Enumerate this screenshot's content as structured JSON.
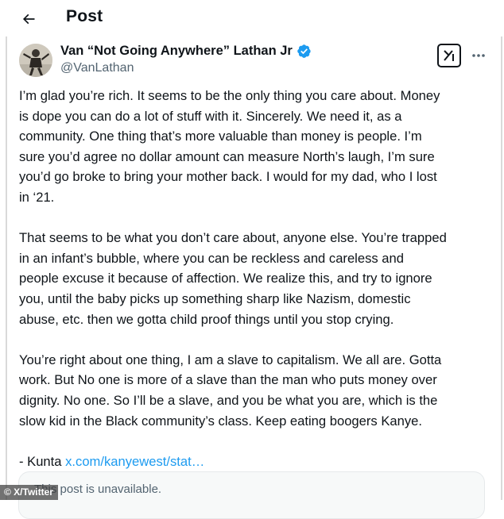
{
  "header": {
    "back_icon": "arrow-left-icon",
    "title": "Post"
  },
  "author": {
    "name": "Van “Not Going Anywhere” Lathan Jr",
    "handle": "@VanLathan",
    "verified_icon": "verified-badge-icon",
    "verified_color": "#1d9bf0"
  },
  "actions": {
    "grok_icon": "grok-icon",
    "more_icon": "more-horizontal-icon"
  },
  "tweet": {
    "paragraphs": [
      [
        "I’m glad you’re rich. It seems to be the only thing you care about. Money",
        "is dope you can do a lot of stuff with it. Sincerely.  We need it, as a",
        "community. One thing that’s more valuable than money is people. I’m",
        "sure you’d agree no dollar amount can measure North’s laugh, I’m sure",
        "you’d go broke to bring your mother back. I would for my dad, who I lost",
        "in ‘21."
      ],
      [
        "That seems to be what you don’t care about, anyone else. You’re trapped",
        "in an infant’s  bubble, where you can be reckless and careless and",
        "people excuse it because of affection. We realize this, and try to ignore",
        "you, until the baby picks up something sharp like Nazism, domestic",
        "abuse, etc. then we gotta child proof things until you stop crying."
      ],
      [
        "You’re right about one thing, I am a slave to capitalism. We all are. Gotta",
        "work. But No one is more of a slave than the man who puts money over",
        "dignity. No one. So I’ll be a slave, and you be what you are, which is the",
        "slow kid in the Black community’s class. Keep eating boogers Kanye."
      ]
    ],
    "signoff_prefix": "- Kunta ",
    "link_text": "x.com/kanyewest/stat…",
    "link_color": "#1d9bf0"
  },
  "quote": {
    "text": "This post is unavailable."
  },
  "watermark": {
    "text": "© X/Twitter"
  }
}
